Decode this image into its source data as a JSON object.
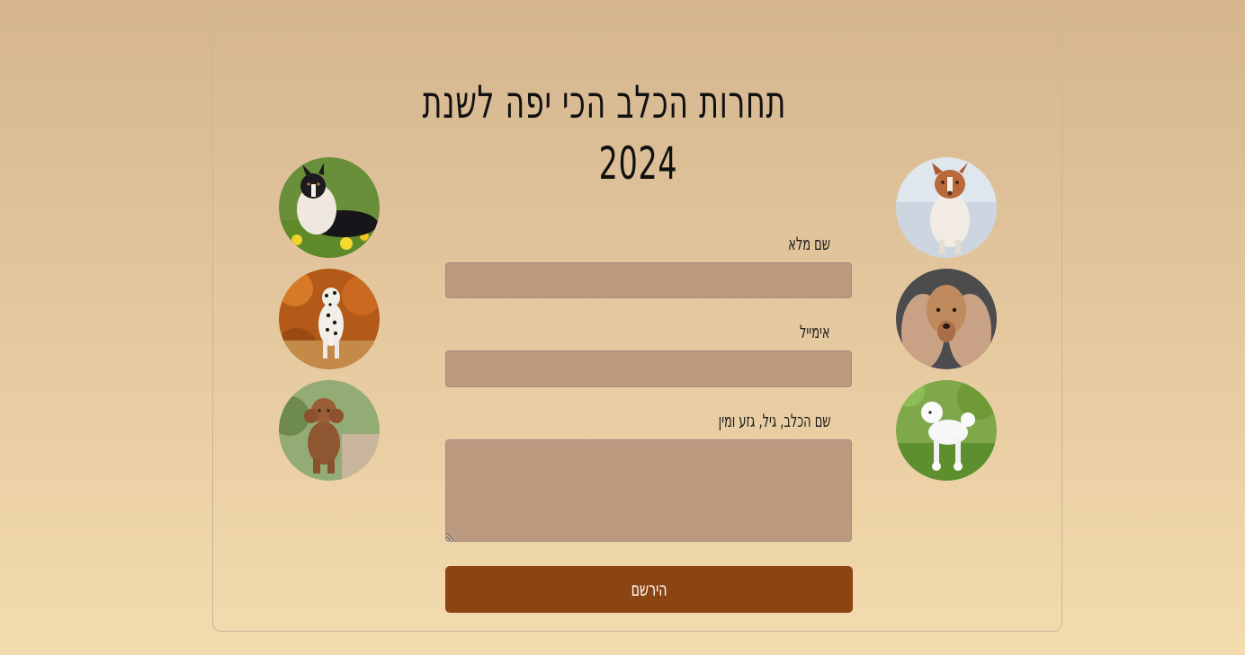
{
  "page": {
    "title_line1": "תחרות הכלב הכי יפה לשנת",
    "title_line2": "2024"
  },
  "gallery": {
    "left": [
      {
        "icon": "australian-shepherd-photo"
      },
      {
        "icon": "dalmatian-photo"
      },
      {
        "icon": "brown-poodle-photo"
      }
    ],
    "right": [
      {
        "icon": "red-merle-shepherd-photo"
      },
      {
        "icon": "afghan-hound-photo"
      },
      {
        "icon": "white-poodle-photo"
      }
    ]
  },
  "form": {
    "name_label": "שם מלא",
    "name_value": "",
    "email_label": "אימייל",
    "email_value": "",
    "dog_label": "שם הכלב, גיל, גזע ומין",
    "dog_value": "",
    "submit_label": "הירשם"
  },
  "colors": {
    "button": "#8b4513",
    "field_bg": "#bc9a80",
    "background_top": "#d5b68f",
    "background_bottom": "#f3dcad"
  }
}
